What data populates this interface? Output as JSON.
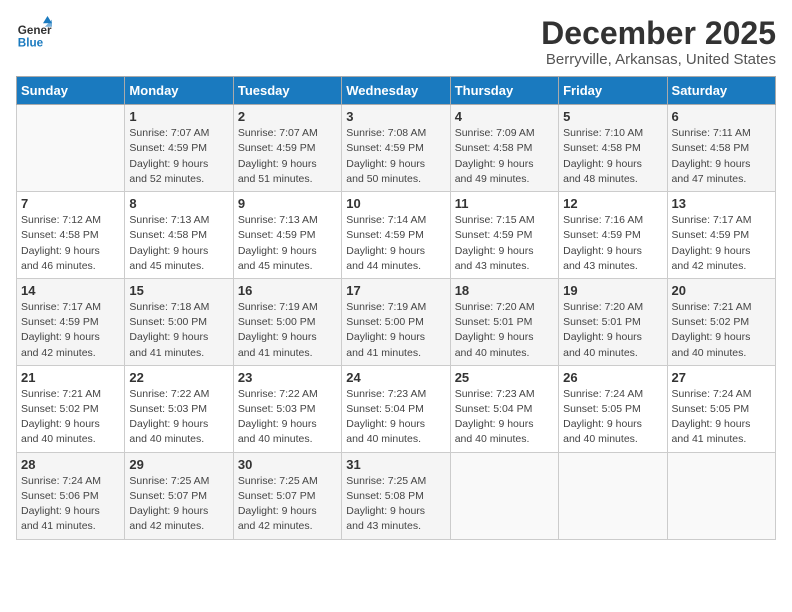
{
  "logo": {
    "line1": "General",
    "line2": "Blue"
  },
  "title": "December 2025",
  "location": "Berryville, Arkansas, United States",
  "weekdays": [
    "Sunday",
    "Monday",
    "Tuesday",
    "Wednesday",
    "Thursday",
    "Friday",
    "Saturday"
  ],
  "weeks": [
    [
      {
        "day": "",
        "info": ""
      },
      {
        "day": "1",
        "info": "Sunrise: 7:07 AM\nSunset: 4:59 PM\nDaylight: 9 hours\nand 52 minutes."
      },
      {
        "day": "2",
        "info": "Sunrise: 7:07 AM\nSunset: 4:59 PM\nDaylight: 9 hours\nand 51 minutes."
      },
      {
        "day": "3",
        "info": "Sunrise: 7:08 AM\nSunset: 4:59 PM\nDaylight: 9 hours\nand 50 minutes."
      },
      {
        "day": "4",
        "info": "Sunrise: 7:09 AM\nSunset: 4:58 PM\nDaylight: 9 hours\nand 49 minutes."
      },
      {
        "day": "5",
        "info": "Sunrise: 7:10 AM\nSunset: 4:58 PM\nDaylight: 9 hours\nand 48 minutes."
      },
      {
        "day": "6",
        "info": "Sunrise: 7:11 AM\nSunset: 4:58 PM\nDaylight: 9 hours\nand 47 minutes."
      }
    ],
    [
      {
        "day": "7",
        "info": "Sunrise: 7:12 AM\nSunset: 4:58 PM\nDaylight: 9 hours\nand 46 minutes."
      },
      {
        "day": "8",
        "info": "Sunrise: 7:13 AM\nSunset: 4:58 PM\nDaylight: 9 hours\nand 45 minutes."
      },
      {
        "day": "9",
        "info": "Sunrise: 7:13 AM\nSunset: 4:59 PM\nDaylight: 9 hours\nand 45 minutes."
      },
      {
        "day": "10",
        "info": "Sunrise: 7:14 AM\nSunset: 4:59 PM\nDaylight: 9 hours\nand 44 minutes."
      },
      {
        "day": "11",
        "info": "Sunrise: 7:15 AM\nSunset: 4:59 PM\nDaylight: 9 hours\nand 43 minutes."
      },
      {
        "day": "12",
        "info": "Sunrise: 7:16 AM\nSunset: 4:59 PM\nDaylight: 9 hours\nand 43 minutes."
      },
      {
        "day": "13",
        "info": "Sunrise: 7:17 AM\nSunset: 4:59 PM\nDaylight: 9 hours\nand 42 minutes."
      }
    ],
    [
      {
        "day": "14",
        "info": "Sunrise: 7:17 AM\nSunset: 4:59 PM\nDaylight: 9 hours\nand 42 minutes."
      },
      {
        "day": "15",
        "info": "Sunrise: 7:18 AM\nSunset: 5:00 PM\nDaylight: 9 hours\nand 41 minutes."
      },
      {
        "day": "16",
        "info": "Sunrise: 7:19 AM\nSunset: 5:00 PM\nDaylight: 9 hours\nand 41 minutes."
      },
      {
        "day": "17",
        "info": "Sunrise: 7:19 AM\nSunset: 5:00 PM\nDaylight: 9 hours\nand 41 minutes."
      },
      {
        "day": "18",
        "info": "Sunrise: 7:20 AM\nSunset: 5:01 PM\nDaylight: 9 hours\nand 40 minutes."
      },
      {
        "day": "19",
        "info": "Sunrise: 7:20 AM\nSunset: 5:01 PM\nDaylight: 9 hours\nand 40 minutes."
      },
      {
        "day": "20",
        "info": "Sunrise: 7:21 AM\nSunset: 5:02 PM\nDaylight: 9 hours\nand 40 minutes."
      }
    ],
    [
      {
        "day": "21",
        "info": "Sunrise: 7:21 AM\nSunset: 5:02 PM\nDaylight: 9 hours\nand 40 minutes."
      },
      {
        "day": "22",
        "info": "Sunrise: 7:22 AM\nSunset: 5:03 PM\nDaylight: 9 hours\nand 40 minutes."
      },
      {
        "day": "23",
        "info": "Sunrise: 7:22 AM\nSunset: 5:03 PM\nDaylight: 9 hours\nand 40 minutes."
      },
      {
        "day": "24",
        "info": "Sunrise: 7:23 AM\nSunset: 5:04 PM\nDaylight: 9 hours\nand 40 minutes."
      },
      {
        "day": "25",
        "info": "Sunrise: 7:23 AM\nSunset: 5:04 PM\nDaylight: 9 hours\nand 40 minutes."
      },
      {
        "day": "26",
        "info": "Sunrise: 7:24 AM\nSunset: 5:05 PM\nDaylight: 9 hours\nand 40 minutes."
      },
      {
        "day": "27",
        "info": "Sunrise: 7:24 AM\nSunset: 5:05 PM\nDaylight: 9 hours\nand 41 minutes."
      }
    ],
    [
      {
        "day": "28",
        "info": "Sunrise: 7:24 AM\nSunset: 5:06 PM\nDaylight: 9 hours\nand 41 minutes."
      },
      {
        "day": "29",
        "info": "Sunrise: 7:25 AM\nSunset: 5:07 PM\nDaylight: 9 hours\nand 42 minutes."
      },
      {
        "day": "30",
        "info": "Sunrise: 7:25 AM\nSunset: 5:07 PM\nDaylight: 9 hours\nand 42 minutes."
      },
      {
        "day": "31",
        "info": "Sunrise: 7:25 AM\nSunset: 5:08 PM\nDaylight: 9 hours\nand 43 minutes."
      },
      {
        "day": "",
        "info": ""
      },
      {
        "day": "",
        "info": ""
      },
      {
        "day": "",
        "info": ""
      }
    ]
  ]
}
